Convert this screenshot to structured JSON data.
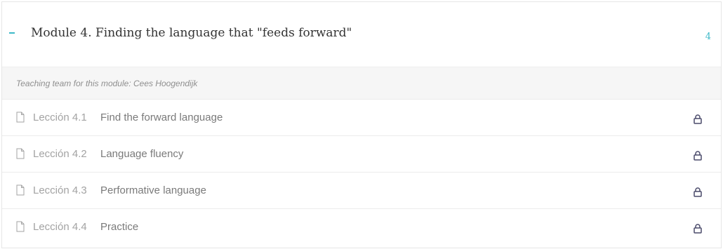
{
  "module": {
    "toggle_icon": "minus-icon",
    "title": "Module 4. Finding the language that \"feeds forward\"",
    "lesson_count": "4",
    "description": "Teaching team for this module: Cees Hoogendijk",
    "accent_color": "#3db9c8",
    "lessons": [
      {
        "number": "Lección 4.1",
        "title": "Find the forward language",
        "icon": "document-icon",
        "status_icon": "lock-icon"
      },
      {
        "number": "Lección 4.2",
        "title": "Language fluency",
        "icon": "document-icon",
        "status_icon": "lock-icon"
      },
      {
        "number": "Lección 4.3",
        "title": "Performative language",
        "icon": "document-icon",
        "status_icon": "lock-icon"
      },
      {
        "number": "Lección 4.4",
        "title": "Practice",
        "icon": "document-icon",
        "status_icon": "lock-icon"
      }
    ]
  }
}
